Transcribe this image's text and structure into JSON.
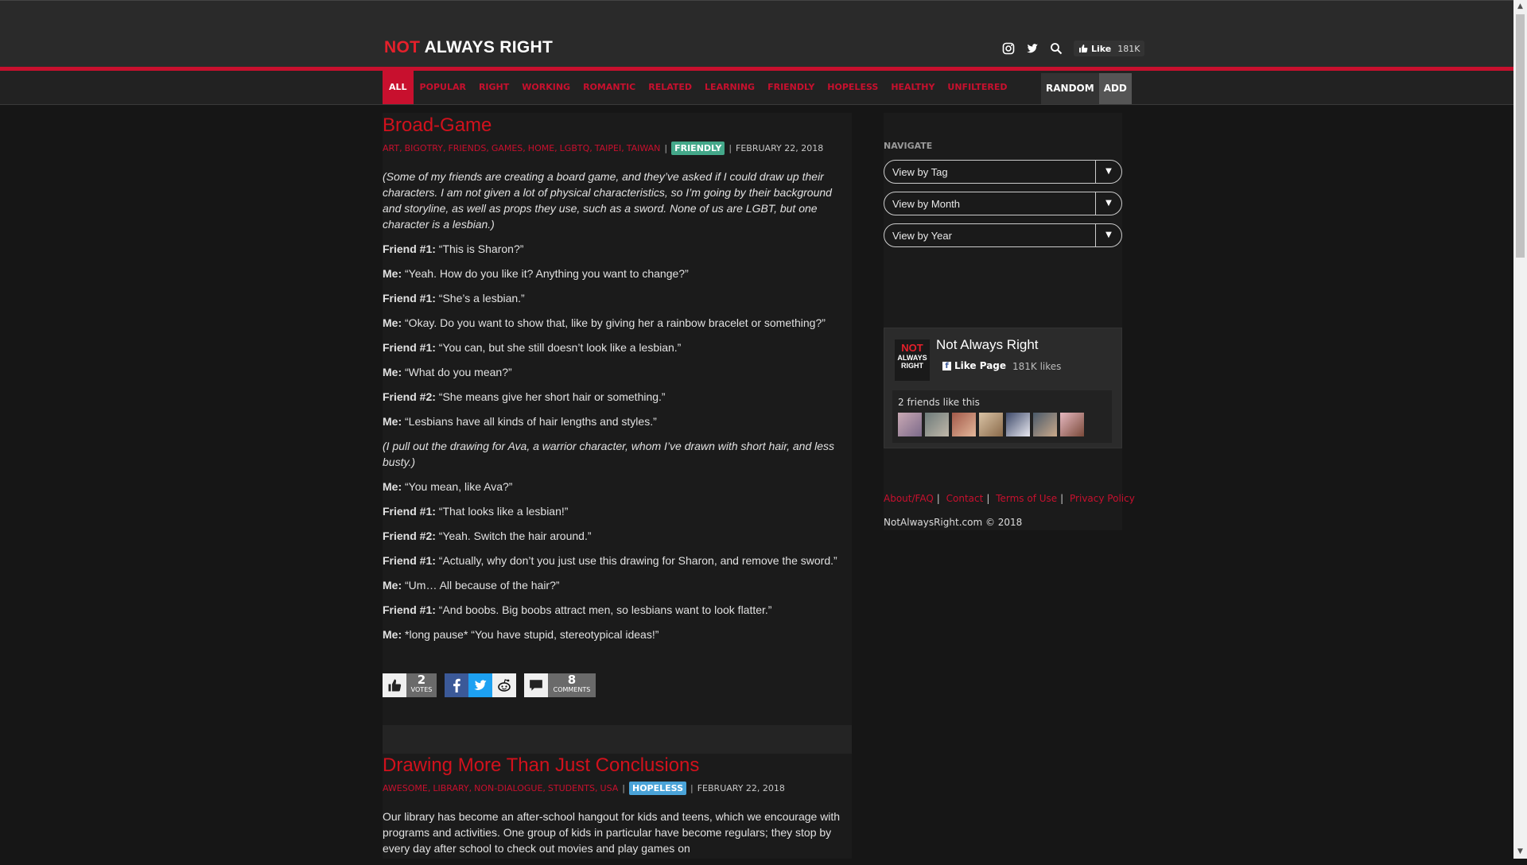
{
  "header": {
    "logo_not": "NOT",
    "logo_rest": "ALWAYS RIGHT",
    "like_label": "Like",
    "like_count": "181K"
  },
  "nav": {
    "items": [
      "ALL",
      "POPULAR",
      "RIGHT",
      "WORKING",
      "ROMANTIC",
      "RELATED",
      "LEARNING",
      "FRIENDLY",
      "HOPELESS",
      "HEALTHY",
      "UNFILTERED"
    ],
    "random": "RANDOM",
    "add": "ADD"
  },
  "story1": {
    "title": "Broad-Game",
    "tags": [
      "ART",
      "BIGOTRY",
      "FRIENDS",
      "GAMES",
      "HOME",
      "LGBTQ",
      "TAIPEI",
      "TAIWAN"
    ],
    "category": "FRIENDLY",
    "date": "FEBRUARY 22, 2018",
    "paragraphs": [
      {
        "style": "italic",
        "speaker": "",
        "text": "(Some of my friends are creating a board game, and they’ve asked if I could draw up their characters. I am not given a lot of physical characteristics, so I’m going by their background and storyline, as well as props they use, such as a sword. None of us are LGBT, but one character is a lesbian.)"
      },
      {
        "style": "normal",
        "speaker": "Friend #1:",
        "text": "“This is Sharon?”"
      },
      {
        "style": "normal",
        "speaker": "Me:",
        "text": "“Yeah. How do you like it? Anything you want to change?”"
      },
      {
        "style": "normal",
        "speaker": "Friend #1:",
        "text": "“She’s a lesbian.”"
      },
      {
        "style": "normal",
        "speaker": "Me:",
        "text": "“Okay. Do you want to show that, like by giving her a rainbow bracelet or something?”"
      },
      {
        "style": "normal",
        "speaker": "Friend #1:",
        "text": "“You can, but she still doesn’t look like a lesbian.”"
      },
      {
        "style": "normal",
        "speaker": "Me:",
        "text": "“What do you mean?”"
      },
      {
        "style": "normal",
        "speaker": "Friend #2:",
        "text": "“She means give her short hair or something.”"
      },
      {
        "style": "normal",
        "speaker": "Me:",
        "text": "“Lesbians have all kinds of hair lengths and styles.”"
      },
      {
        "style": "italic",
        "speaker": "",
        "text": "(I pull out the drawing for Ava, a warrior character, whom I’ve drawn with short hair, and less busty.)"
      },
      {
        "style": "normal",
        "speaker": "Me:",
        "text": "“You mean, like Ava?”"
      },
      {
        "style": "normal",
        "speaker": "Friend #1:",
        "text": "“That looks like a lesbian!”"
      },
      {
        "style": "normal",
        "speaker": "Friend #2:",
        "text": "“Yeah. Switch the hair around.”"
      },
      {
        "style": "normal",
        "speaker": "Friend #1:",
        "text": "“Actually, why don’t you just use this drawing for Sharon, and remove the sword.”"
      },
      {
        "style": "normal",
        "speaker": "Me:",
        "text": "“Um… All because of the hair?”"
      },
      {
        "style": "normal",
        "speaker": "Friend #1:",
        "text": "“And boobs. Big boobs attract men, so lesbians want to look flatter.”"
      },
      {
        "style": "normal",
        "speaker": "Me:",
        "text": "*long pause* “You have stupid, stereotypical ideas!”"
      }
    ],
    "votes": "2",
    "votes_label": "VOTES",
    "comments": "8",
    "comments_label": "COMMENTS"
  },
  "story2": {
    "title": "Drawing More Than Just Conclusions",
    "tags": [
      "AWESOME",
      "LIBRARY",
      "NON-DIALOGUE",
      "STUDENTS",
      "USA"
    ],
    "category": "HOPELESS",
    "date": "FEBRUARY 22, 2018",
    "text": "Our library has become an after-school hangout for kids and teens, which we encourage with programs and activities. One group of kids in particular have become regulars; they stop by every day after school to check out movies and play games on"
  },
  "sidebar": {
    "navigate_label": "NAVIGATE",
    "selects": [
      "View by Tag",
      "View by Month",
      "View by Year"
    ],
    "fb_page_name": "Not Always Right",
    "fb_like_page": "Like Page",
    "fb_likes": "181K likes",
    "fb_friends": "2 friends like this",
    "logo_line1": "NOT",
    "logo_line2": "ALWAYS",
    "logo_line3": "RIGHT",
    "footer_links": [
      "About/FAQ",
      "Contact",
      "Terms of Use",
      "Privacy Policy"
    ],
    "copyright": "NotAlwaysRight.com © 2018"
  },
  "colors": {
    "accent": "#c8102e",
    "friendly": "#44a88a",
    "hopeless": "#4aa3d8"
  }
}
